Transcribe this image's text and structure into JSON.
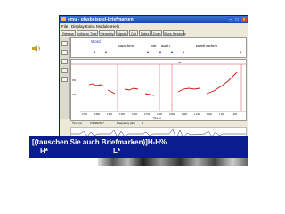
{
  "window": {
    "title": "emu - glasbeispiel-briefmarken",
    "menu": [
      "File",
      "Display",
      "Extra",
      "Modules",
      "Help"
    ],
    "toolbar": [
      "Release",
      "Initialize Time",
      "Hierarchy",
      "Signals",
      "Dat",
      "Sakes",
      "Zoom",
      "Show Hierarchy"
    ]
  },
  "annotation": {
    "header": "Word",
    "words": [
      "tauschen",
      "Sie",
      "auch",
      "Briefmarken"
    ]
  },
  "pitch": {
    "top_label": "94",
    "x_ticks": [
      "0.702",
      "0.802",
      "0.902",
      "0.902",
      "0.902",
      "0.702",
      "0.802",
      "0.902",
      "1.002",
      "1.102",
      "1.202",
      "1.302",
      "1.402"
    ],
    "x_label": "Time (s)",
    "y_ticks": [
      "150",
      "100"
    ]
  },
  "status": {
    "time_label": "Time (s)",
    "time_value": "0.58262677",
    "info_label": "Frequency (Hz)",
    "info_value": "0"
  },
  "overlay": {
    "line1": "[(tauschen Sie auch Briefmarken)]H-H%",
    "line2_left": "H*",
    "line2_right": "L*"
  },
  "colors": {
    "overlay_bg": "#0b1c8e",
    "pitch_curve": "#cc1111",
    "annotation_marker": "#cc1111",
    "title_bar": "#1748b4"
  }
}
